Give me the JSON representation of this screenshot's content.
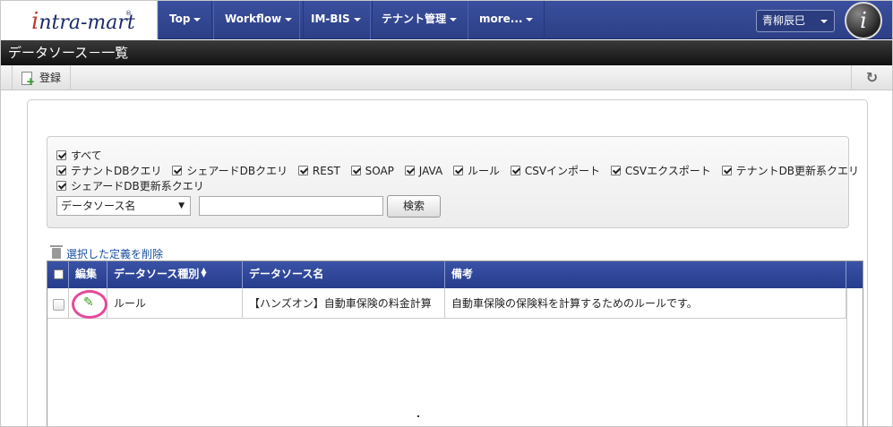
{
  "nav": {
    "brand": "intra-mart",
    "items": [
      {
        "label": "Top"
      },
      {
        "label": "Workflow"
      },
      {
        "label": "IM-BIS"
      },
      {
        "label": "テナント管理"
      },
      {
        "label": "more..."
      }
    ],
    "user": "青柳辰巳"
  },
  "page": {
    "title": "データソース－一覧"
  },
  "toolbar": {
    "register_label": "登録",
    "refresh_icon": "refresh-icon"
  },
  "search": {
    "all_label": "すべて",
    "options": [
      {
        "label": "テナントDBクエリ",
        "checked": true
      },
      {
        "label": "シェアードDBクエリ",
        "checked": true
      },
      {
        "label": "REST",
        "checked": true
      },
      {
        "label": "SOAP",
        "checked": true
      },
      {
        "label": "JAVA",
        "checked": true
      },
      {
        "label": "ルール",
        "checked": true
      },
      {
        "label": "CSVインポート",
        "checked": true
      },
      {
        "label": "CSVエクスポート",
        "checked": true
      },
      {
        "label": "テナントDB更新系クエリ",
        "checked": true
      },
      {
        "label": "シェアードDB更新系クエリ",
        "checked": true
      }
    ],
    "select_value": "データソース名",
    "input_value": "",
    "button_label": "検索"
  },
  "delete_link": "選択した定義を削除",
  "grid": {
    "columns": [
      "編集",
      "データソース種別",
      "データソース名",
      "備考"
    ],
    "rows": [
      {
        "type": "ルール",
        "name": "【ハンズオン】自動車保険の料金計算",
        "note": "自動車保険の保険料を計算するためのルールです。"
      }
    ]
  },
  "colors": {
    "nav": "#2c3f86",
    "title": "#111111",
    "highlight": "#e8499a",
    "pencil": "#3b9b1b"
  }
}
